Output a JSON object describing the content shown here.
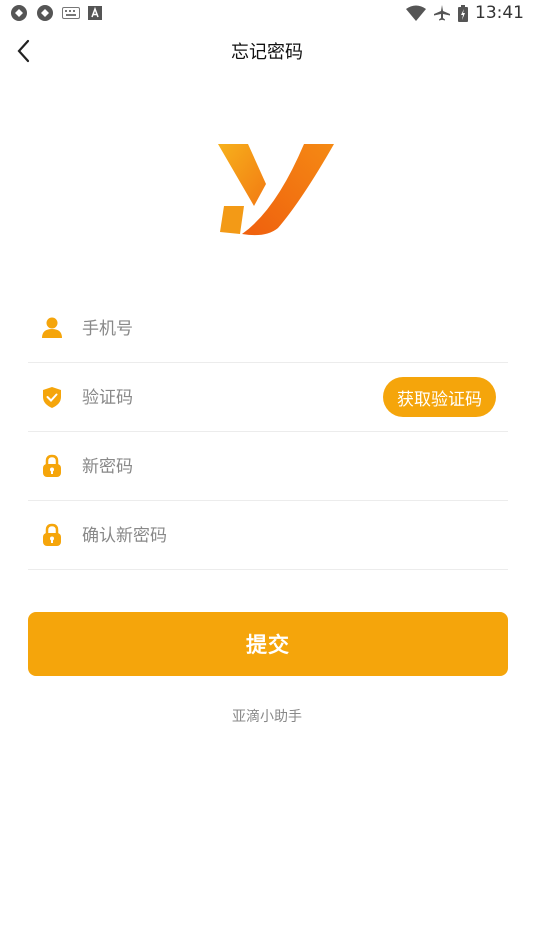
{
  "status_bar": {
    "time": "13:41",
    "left_icons": [
      "sync-icon",
      "sync-icon",
      "keyboard-icon",
      "text-icon"
    ],
    "right_icons": [
      "wifi-icon",
      "airplane-icon",
      "battery-icon"
    ]
  },
  "nav": {
    "title": "忘记密码",
    "back_icon": "chevron-left-icon"
  },
  "brand": {
    "logo_icon": "y-logo-icon",
    "accent": "#f5a50b",
    "logo_gradient": [
      "#f7b11c",
      "#f16a0f"
    ]
  },
  "form": {
    "phone": {
      "placeholder": "手机号",
      "value": "",
      "icon": "user-icon"
    },
    "code": {
      "placeholder": "验证码",
      "value": "",
      "icon": "shield-check-icon",
      "button_label": "获取验证码"
    },
    "new_password": {
      "placeholder": "新密码",
      "value": "",
      "icon": "lock-icon"
    },
    "confirm_password": {
      "placeholder": "确认新密码",
      "value": "",
      "icon": "lock-icon"
    }
  },
  "submit": {
    "label": "提交"
  },
  "footer": {
    "text": "亚滴小助手"
  }
}
